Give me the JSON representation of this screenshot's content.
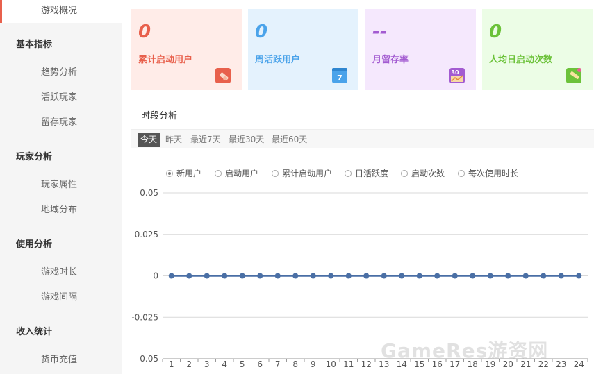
{
  "sidebar": {
    "active_item": "游戏概况",
    "groups": [
      {
        "title": "基本指标",
        "items": [
          "趋势分析",
          "活跃玩家",
          "留存玩家"
        ]
      },
      {
        "title": "玩家分析",
        "items": [
          "玩家属性",
          "地域分布"
        ]
      },
      {
        "title": "使用分析",
        "items": [
          "游戏时长",
          "游戏间隔"
        ]
      },
      {
        "title": "收入统计",
        "items": [
          "货币充值"
        ]
      }
    ]
  },
  "cards": [
    {
      "value": "0",
      "label": "累计启动用户",
      "icon": "pencil-eraser-icon",
      "color": "#e8604c",
      "bg": "#ffece8"
    },
    {
      "value": "0",
      "label": "周活跃用户",
      "icon": "calendar-7-icon",
      "color": "#4aa3ea",
      "bg": "#e4f2fd"
    },
    {
      "value": "--",
      "label": "月留存率",
      "icon": "calendar-30-chart-icon",
      "color": "#a35bd1",
      "bg": "#f5e8fd"
    },
    {
      "value": "0",
      "label": "人均日启动次数",
      "icon": "pencil-note-icon",
      "color": "#6cc23a",
      "bg": "#ecfde6"
    }
  ],
  "section": {
    "title": "时段分析",
    "tabs": [
      "今天",
      "昨天",
      "最近7天",
      "最近30天",
      "最近60天"
    ],
    "active_tab": "今天"
  },
  "legend": {
    "items": [
      "新用户",
      "启动用户",
      "累计启动用户",
      "日活跃度",
      "启动次数",
      "每次使用时长"
    ],
    "selected": "新用户"
  },
  "chart_data": {
    "type": "line",
    "x": [
      1,
      2,
      3,
      4,
      5,
      6,
      7,
      8,
      9,
      10,
      11,
      12,
      13,
      14,
      15,
      16,
      17,
      18,
      19,
      20,
      21,
      22,
      23,
      24
    ],
    "y_ticks": [
      "0.05",
      "0.025",
      "0",
      "-0.025",
      "-0.05"
    ],
    "ylim": [
      -0.05,
      0.05
    ],
    "series": [
      {
        "name": "新用户",
        "values": [
          0,
          0,
          0,
          0,
          0,
          0,
          0,
          0,
          0,
          0,
          0,
          0,
          0,
          0,
          0,
          0,
          0,
          0,
          0,
          0,
          0,
          0,
          0,
          0
        ],
        "color": "#4a6fa5"
      }
    ],
    "grid": true
  },
  "watermark": "GameRes游资网"
}
